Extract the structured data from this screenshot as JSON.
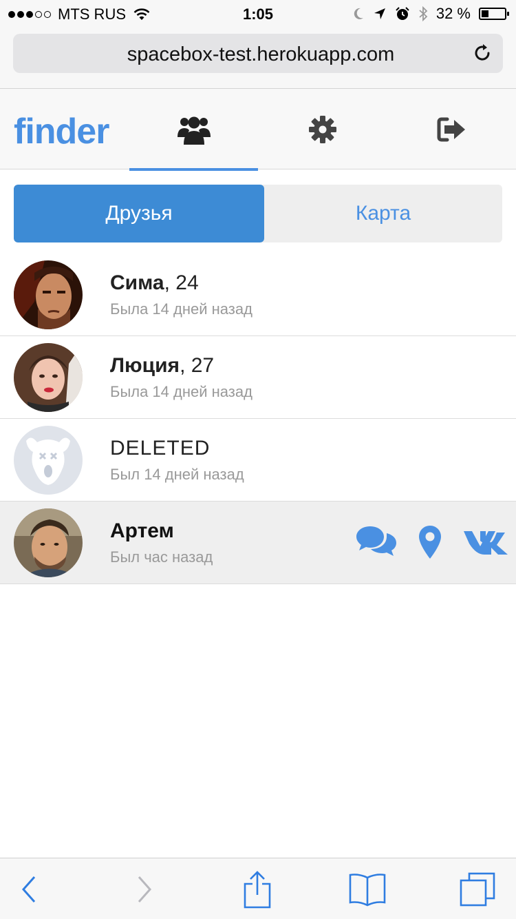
{
  "status_bar": {
    "carrier": "MTS RUS",
    "time": "1:05",
    "battery": "32 %",
    "battery_level": 0.32,
    "signal_filled": 3,
    "signal_total": 5
  },
  "browser": {
    "url": "spacebox-test.herokuapp.com"
  },
  "app": {
    "logo": "finder",
    "accent_color": "#4a90e2",
    "nav": [
      {
        "icon": "users-icon",
        "active": true
      },
      {
        "icon": "gear-icon",
        "active": false
      },
      {
        "icon": "sign-out-icon",
        "active": false
      }
    ]
  },
  "segments": {
    "friends": "Друзья",
    "map": "Карта"
  },
  "friends": [
    {
      "name": "Сима",
      "age": ", 24",
      "status": "Была 14 дней назад"
    },
    {
      "name": "Люция",
      "age": ", 27",
      "status": "Была 14 дней назад"
    },
    {
      "name": "DELETED",
      "age": "",
      "status": "Был 14 дней назад"
    },
    {
      "name": "Артем",
      "age": "",
      "status": "Был час назад",
      "selected": true
    }
  ],
  "row_actions": {
    "icons": [
      "comments-icon",
      "map-marker-icon",
      "vk-icon"
    ]
  },
  "toolbar": {
    "icons": [
      "back-icon",
      "forward-icon",
      "share-icon",
      "bookmarks-icon",
      "tabs-icon"
    ]
  }
}
